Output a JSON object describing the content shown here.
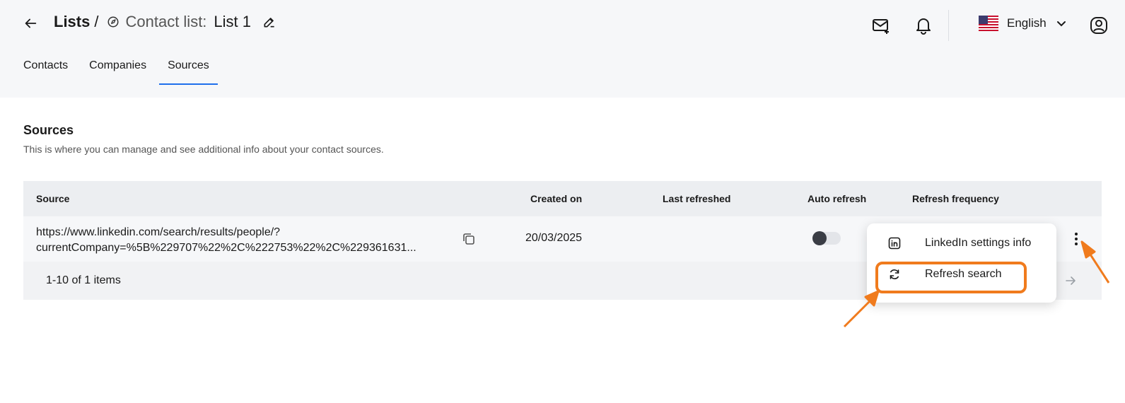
{
  "header": {
    "breadcrumb_root": "Lists",
    "breadcrumb_sep": "/",
    "list_label": "Contact list:",
    "list_name": "List 1",
    "language": "English"
  },
  "tabs": [
    {
      "label": "Contacts",
      "active": false
    },
    {
      "label": "Companies",
      "active": false
    },
    {
      "label": "Sources",
      "active": true
    }
  ],
  "section": {
    "title": "Sources",
    "subtitle": "This is where you can manage and see additional info about your contact sources."
  },
  "table": {
    "columns": [
      "Source",
      "Created on",
      "Last refreshed",
      "Auto refresh",
      "Refresh frequency"
    ],
    "rows": [
      {
        "source_line1": "https://www.linkedin.com/search/results/people/?",
        "source_line2": "currentCompany=%5B%229707%22%2C%222753%22%2C%229361631...",
        "created_on": "20/03/2025",
        "last_refreshed": "",
        "auto_refresh": false,
        "refresh_frequency": ""
      }
    ],
    "pagination": "1-10 of 1 items"
  },
  "context_menu": {
    "items": [
      {
        "label": "LinkedIn settings info",
        "icon": "linkedin-icon"
      },
      {
        "label": "Refresh search",
        "icon": "refresh-icon"
      }
    ]
  },
  "colors": {
    "accent": "#1f6feb",
    "annotation": "#f07b1d"
  }
}
